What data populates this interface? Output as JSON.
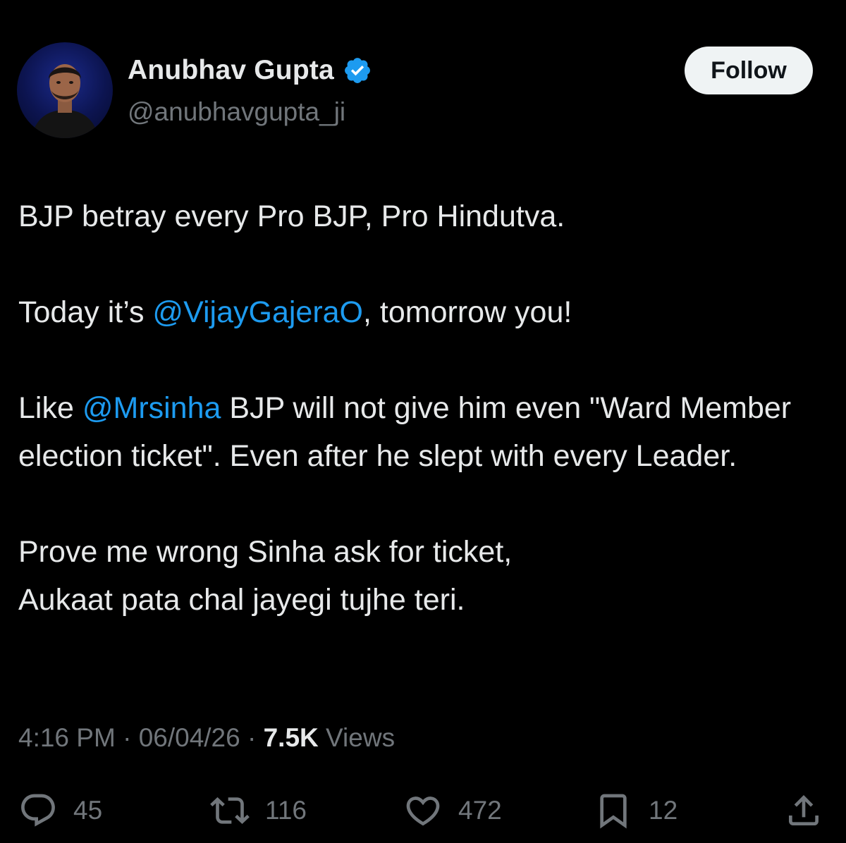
{
  "author": {
    "display_name": "Anubhav Gupta",
    "handle": "@anubhavgupta_ji",
    "verified_icon": "verified-badge-icon",
    "verified_color": "#1d9bf0"
  },
  "follow_button": {
    "label": "Follow"
  },
  "tweet": {
    "line1": "BJP betray every Pro BJP, Pro Hindutva.",
    "line2_prefix": "Today it’s ",
    "line2_mention": "@VijayGajeraO",
    "line2_suffix": ", tomorrow you!",
    "line3_prefix": "Like ",
    "line3_mention": "@Mrsinha",
    "line3_suffix": " BJP will not give him even \"Ward Member election ticket\". Even after he slept with every Leader.",
    "line4a": "Prove me wrong Sinha ask for ticket,",
    "line4b": "Aukaat pata chal jayegi tujhe teri."
  },
  "meta": {
    "time": "4:16 PM",
    "separator": " · ",
    "date": "06/04/26",
    "views_count": "7.5K",
    "views_label": " Views"
  },
  "actions": {
    "reply": {
      "icon": "reply-icon",
      "count": "45"
    },
    "retweet": {
      "icon": "retweet-icon",
      "count": "116"
    },
    "like": {
      "icon": "heart-icon",
      "count": "472"
    },
    "bookmark": {
      "icon": "bookmark-icon",
      "count": "12"
    },
    "share": {
      "icon": "share-icon"
    }
  },
  "colors": {
    "background": "#000000",
    "text": "#e7e9ea",
    "secondary": "#71767b",
    "link": "#1d9bf0"
  }
}
